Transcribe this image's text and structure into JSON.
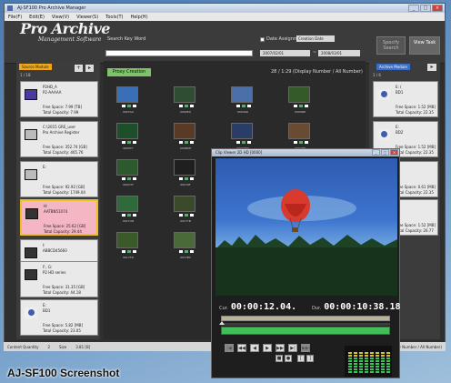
{
  "window": {
    "title": "AJ-SF100 Pro Archive Manager",
    "buttons": [
      "_",
      "□",
      "×"
    ]
  },
  "menu": [
    "File(F)",
    "Edit(E)",
    "View(V)",
    "Viewer(S)",
    "Tools(T)",
    "Help(H)"
  ],
  "header": {
    "logo": "Pro Archive",
    "logo_sub": "Management Software",
    "keyword_label": "Search Key Word",
    "keyword_value": "",
    "date_assign_label": "Date Assignment",
    "date_select": "Creation Date",
    "date_from": "2007/02/01",
    "date_sep": "~",
    "date_to": "2008/03/01",
    "search_button": "Specify Search",
    "view_task_button": "View Task"
  },
  "left_panel": {
    "tag": "Source Module",
    "count": "1 / 18",
    "buttons": [
      "+",
      "▸"
    ],
    "cards": [
      {
        "line1": "P2HD_A",
        "line2": "P2-AAAAA",
        "free": "Free Space: 7.99 [TB]",
        "total": "Total Capacity: 7.99"
      },
      {
        "line1": "C:\\2015 GRE_user",
        "line2": "Pro Archive Register",
        "free": "Free Space: 352.74 [GB]",
        "total": "Total Capacity: 465.76"
      },
      {
        "line1": "E:",
        "line2": "",
        "free": "Free Space: 92.92 [GB]",
        "total": "Total Capacity: 1749.04"
      },
      {
        "line1": "H:",
        "line2": "AATBN51074",
        "free": "Free Space: 25.62 [GB]",
        "total": "Total Capacity: 29.44"
      },
      {
        "line1": "I:",
        "line2": "ABBCD45660",
        "free": "Free Space: 31.60 [GB]",
        "total": "Total Capacity: 31.74"
      },
      {
        "line1": "F:, G:",
        "line2": "P2 HD series",
        "free": "Free Space: 31.35 [GB]",
        "total": "Total Capacity: 44.18"
      },
      {
        "line1": "E:",
        "line2": "BD1",
        "free": "Free Space: 5.82 [MB]",
        "total": "Total Capacity: 23.05"
      }
    ]
  },
  "center": {
    "proxy_button": "Proxy Creation",
    "count": "28 / 1:29   (Display Number / All Number)",
    "clips": [
      "0007GX",
      "0002EQ",
      "0003GR",
      "0004NZ",
      "0005TY",
      "000MKE",
      "0009WW",
      "000A6E",
      "000C3T",
      "00079F",
      "000AFD",
      "000XRT",
      "0017CM",
      "0017YB",
      "",
      "",
      "0017TD",
      "0017BC",
      "",
      ""
    ]
  },
  "right_panel": {
    "tag": "Archive Module",
    "count": "1 / 6",
    "cards": [
      {
        "line1": "E: (",
        "line2": "BD1",
        "free": "Free Space: 1.52 [MB]",
        "total": "Total Capacity: 22.35"
      },
      {
        "line1": "E:",
        "line2": "BD2",
        "free": "Free Space: 1.52 [MB]",
        "total": "Total Capacity: 22.35"
      },
      {
        "line1": "F:",
        "line2": "",
        "free": "Free Space: 0.61 [MB]",
        "total": "Total Capacity: 22.35"
      },
      {
        "line1": "G:",
        "line2": "",
        "free": "Free Space: 1.52 [MB]",
        "total": "Total Capacity: 26.77"
      }
    ]
  },
  "status": {
    "quantity_label": "Content Quantity",
    "quantity": "2",
    "size_label": "Size",
    "size": "3.81 [B]",
    "right": "(Display Number / All Number)"
  },
  "player": {
    "title": "Clip Viewer  2D  HD  [0000]",
    "cur_label": "Cur.",
    "cur": "00:00:12.04.",
    "dur_label": "Dur.",
    "dur": "00:00:10:38.18",
    "transport": [
      "|◀",
      "◀◀",
      "◀",
      "▶",
      "▶▶",
      "▶|",
      "▶▶|"
    ],
    "secondary": [
      "■",
      "●",
      "[",
      "]"
    ]
  },
  "caption": "AJ-SF100 Screenshot",
  "colors": {
    "accent_orange": "#f0a71a",
    "accent_green": "#7fc26a",
    "accent_blue": "#3b6fc8",
    "selected_pink": "#f5b6c4",
    "meter_green": "#39c35a"
  }
}
